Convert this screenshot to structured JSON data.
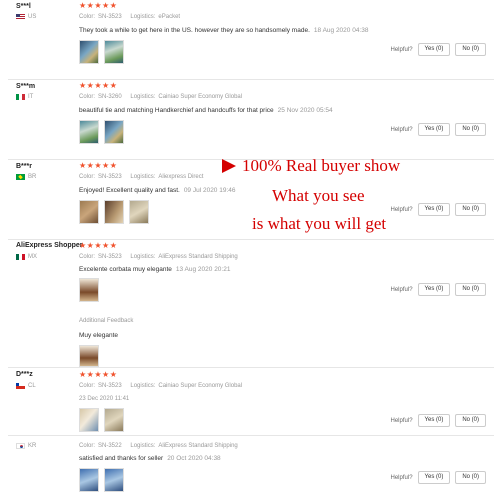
{
  "labels": {
    "color": "Color:",
    "logistics": "Logistics:",
    "helpful": "Helpful?",
    "yes": "Yes (0)",
    "no": "No (0)",
    "stars": "★★★★★"
  },
  "reviews": [
    {
      "user": "S***l",
      "country": "US",
      "color": "SN-3523",
      "logistics": "ePacket",
      "text": "They took a while to get here in the US. however they are so handsomely made.",
      "date": "18 Aug 2020 04:38",
      "photos": 2
    },
    {
      "user": "S***m",
      "country": "IT",
      "color": "SN-3260",
      "logistics": "Cainiao Super Economy Global",
      "text": "beautiful tie and matching Handkerchief and handcuffs for that price",
      "date": "25 Nov 2020 05:54",
      "photos": 2
    },
    {
      "user": "B***r",
      "country": "BR",
      "color": "SN-3523",
      "logistics": "Aliexpress Direct",
      "text": "Enjoyed! Excellent quality and fast.",
      "date": "09 Jul 2020 19:46",
      "photos": 3
    },
    {
      "user": "AliExpress Shopper",
      "country": "MX",
      "color": "SN-3523",
      "logistics": "AliExpress Standard Shipping",
      "text": "Excelente corbata muy elegante",
      "date": "13 Aug 2020 20:21",
      "photos": 1,
      "additional_title": "Additional Feedback",
      "additional_text": "Muy elegante"
    },
    {
      "user": "D***z",
      "country": "CL",
      "color": "SN-3523",
      "logistics": "Cainiao Super Economy Global",
      "text": "",
      "date": "23 Dec 2020 11:41",
      "photos": 2
    },
    {
      "user": "",
      "country": "KR",
      "color": "SN-3522",
      "logistics": "AliExpress Standard Shipping",
      "text": "satisfied and thanks for seller",
      "date": "20 Oct 2020 04:38",
      "photos": 2
    }
  ],
  "overlay": {
    "line1": "100% Real buyer show",
    "line2": "What you see",
    "line3": "is what you will get",
    "color": "#d40000"
  }
}
